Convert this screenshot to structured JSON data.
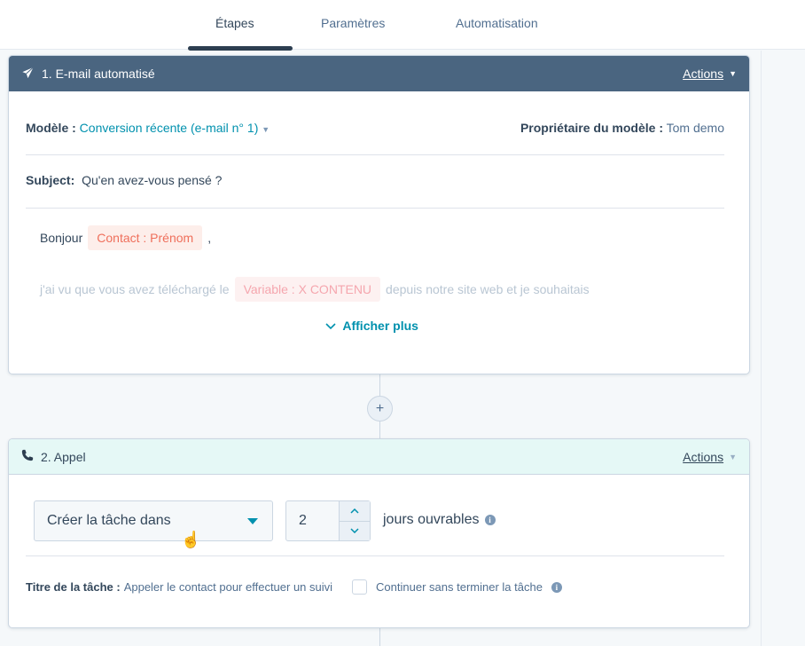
{
  "tabs": [
    {
      "label": "Étapes",
      "active": true
    },
    {
      "label": "Paramètres",
      "active": false
    },
    {
      "label": "Automatisation",
      "active": false
    }
  ],
  "colors": {
    "header_dark": "#4a6580",
    "header_teal": "#e5f8f6",
    "accent_teal": "#0091ae",
    "token_orange": "#ef6f5b",
    "background": "#f5f8fa"
  },
  "step1": {
    "icon": "paper-plane-icon",
    "title": "1. E-mail automatisé",
    "actions_label": "Actions",
    "template_label": "Modèle :",
    "template_value": "Conversion récente (e-mail n° 1)",
    "owner_label": "Propriétaire du modèle :",
    "owner_value": "Tom demo",
    "subject_label": "Subject:",
    "subject_value": "Qu'en avez-vous pensé ?",
    "body": {
      "greeting": "Bonjour",
      "greeting_token": "Contact : Prénom",
      "greeting_suffix": ",",
      "line2_prefix": "j'ai vu que vous avez téléchargé le",
      "line2_token": "Variable : X CONTENU",
      "line2_suffix": "depuis notre site web et je souhaitais"
    },
    "show_more_label": "Afficher plus"
  },
  "add_step_label": "+",
  "step2": {
    "icon": "phone-icon",
    "title": "2. Appel",
    "actions_label": "Actions",
    "create_task_select": "Créer la tâche dans",
    "days_value": "2",
    "days_label": "jours ouvrables",
    "task_title_label": "Titre de la tâche :",
    "task_title_value": "Appeler le contact pour effectuer un suivi",
    "continue_checkbox_label": "Continuer sans terminer la tâche",
    "continue_checked": false
  }
}
